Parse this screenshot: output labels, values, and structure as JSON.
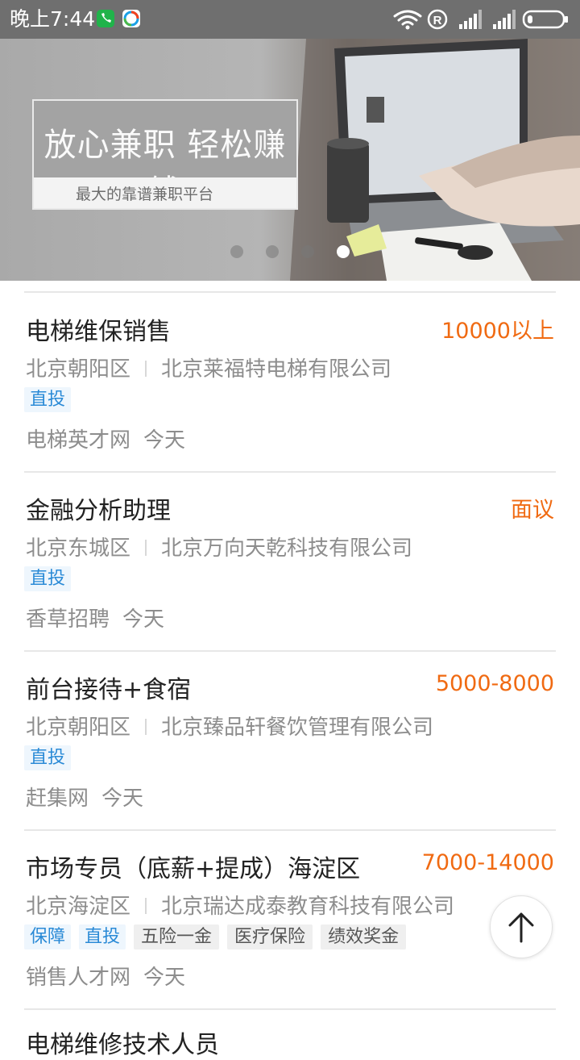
{
  "status_bar": {
    "time": "晚上7:44",
    "icons": [
      "phone-app-icon",
      "app-icon",
      "wifi-icon",
      "registered-icon",
      "signal-icon",
      "signal-icon",
      "battery-icon"
    ],
    "wifi_level": 0.75,
    "battery_level": 0.1
  },
  "banner": {
    "title": "放心兼职 轻松赚钱",
    "subtitle": "最大的靠谱兼职平台",
    "active_slide": 4,
    "slide_count": 4
  },
  "jobs": [
    {
      "title": "电梯维保销售",
      "salary": "10000以上",
      "district": "北京朝阳区",
      "company": "北京莱福特电梯有限公司",
      "tags_blue": [
        "直投"
      ],
      "tags_gray": [],
      "source": "电梯英才网",
      "date": "今天"
    },
    {
      "title": "金融分析助理",
      "salary": "面议",
      "district": "北京东城区",
      "company": "北京万向天乾科技有限公司",
      "tags_blue": [
        "直投"
      ],
      "tags_gray": [],
      "source": "香草招聘",
      "date": "今天"
    },
    {
      "title": "前台接待+食宿",
      "salary": "5000-8000",
      "district": "北京朝阳区",
      "company": "北京臻品轩餐饮管理有限公司",
      "tags_blue": [
        "直投"
      ],
      "tags_gray": [],
      "source": "赶集网",
      "date": "今天"
    },
    {
      "title": "市场专员（底薪+提成）海淀区",
      "salary": "7000-14000",
      "district": "北京海淀区",
      "company": "北京瑞达成泰教育科技有限公司",
      "tags_blue": [
        "保障",
        "直投"
      ],
      "tags_gray": [
        "五险一金",
        "医疗保险",
        "绩效奖金"
      ],
      "source": "销售人才网",
      "date": "今天"
    }
  ],
  "next_job_peek": {
    "title": "电梯维修技术人员"
  },
  "colors": {
    "salary": "#f06a12",
    "tag_blue_text": "#2a8ad6",
    "tag_blue_bg": "#eef6fd",
    "status_bar_bg": "#6f6f6f"
  }
}
